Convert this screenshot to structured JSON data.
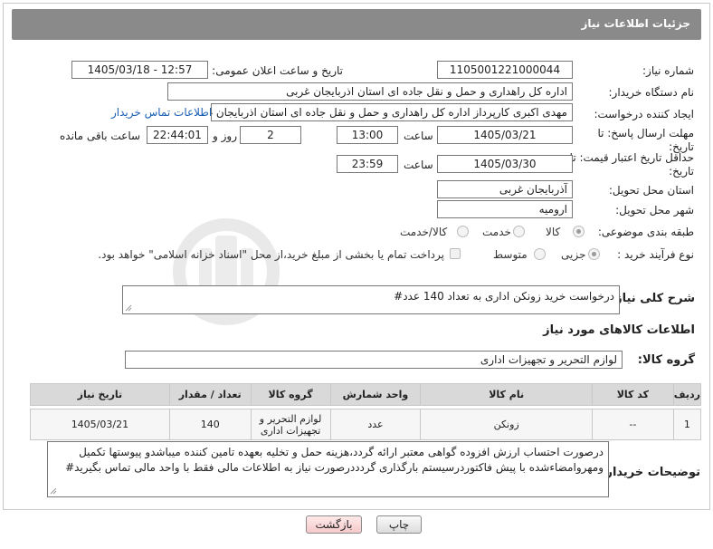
{
  "header": {
    "title": "جزئیات اطلاعات نیاز"
  },
  "fields": {
    "need_number": {
      "label": "شماره نیاز:",
      "value": "1105001221000044"
    },
    "announce": {
      "label": "تاریخ و ساعت اعلان عمومی:",
      "value": "1405/03/18 - 12:57"
    },
    "buyer_org": {
      "label": "نام دستگاه خریدار:",
      "value": "اداره کل راهداری و حمل و نقل جاده ای استان اذربایجان غربی"
    },
    "creator": {
      "label": "ایجاد کننده درخواست:",
      "value": "مهدی اکبری کارپرداز اداره کل راهداری و حمل و نقل جاده ای استان اذربایجان غربی",
      "contact_link": "اطلاعات تماس خریدار"
    },
    "reply_deadline": {
      "label": "مهلت ارسال پاسخ: تا تاریخ:",
      "date": "1405/03/21",
      "time_label": "ساعت",
      "time": "13:00",
      "days": "2",
      "days_label": "روز و",
      "remaining": "22:44:01",
      "remaining_label": "ساعت باقی مانده"
    },
    "price_deadline": {
      "label": "حداقل تاریخ اعتبار قیمت: تا تاریخ:",
      "date": "1405/03/30",
      "time_label": "ساعت",
      "time": "23:59"
    },
    "province": {
      "label": "استان محل تحویل:",
      "value": "آذربایجان غربی"
    },
    "city": {
      "label": "شهر محل تحویل:",
      "value": "ارومیه"
    },
    "category": {
      "label": "طبقه بندی موضوعی:",
      "options": [
        "کالا",
        "خدمت",
        "کالا/خدمت"
      ],
      "selected": "کالا"
    },
    "process": {
      "label": "نوع فرآیند خرید :",
      "options": [
        "جزیی",
        "متوسط"
      ],
      "selected": "جزیی",
      "note": "پرداخت تمام یا بخشی از مبلغ خرید،از محل \"اسناد خزانه اسلامی\" خواهد بود."
    }
  },
  "description": {
    "label": "شرح کلی نیاز:",
    "value": "درخواست خرید زونکن اداری به تعداد 140 عدد#"
  },
  "goods_section": {
    "title": "اطلاعات کالاهای مورد نیاز",
    "group_label": "گروه کالا:",
    "group_value": "لوازم التحریر و تجهیزات اداری"
  },
  "table": {
    "headers": [
      "ردیف",
      "کد کالا",
      "نام کالا",
      "واحد شمارش",
      "گروه کالا",
      "تعداد / مقدار",
      "تاریخ نیاز"
    ],
    "rows": [
      {
        "row": "1",
        "code": "--",
        "name": "زونکن",
        "unit": "عدد",
        "group": "لوازم التحریر و تجهیزات اداری",
        "qty": "140",
        "date": "1405/03/21"
      }
    ]
  },
  "buyer_notes": {
    "label": "توضیحات خریدار:",
    "value": "درصورت احتساب ارزش افزوده گواهی معتبر ارائه گردد،هزینه حمل و تخلیه بعهده تامین کننده میباشدو پیوستها تکمیل ومهروامضاءشده با پیش فاکتوردرسیستم بارگذاری گردددرصورت نیاز به اطلاعات مالی فقط با واحد مالی تماس بگیرید#"
  },
  "buttons": {
    "print": "چاپ",
    "back": "بازگشت"
  },
  "colors": {
    "header_bg": "#8a8a8a",
    "link": "#1a5fb4",
    "table_header_bg": "#d9d9d9",
    "back_button_bg": "#f5c9c9"
  }
}
